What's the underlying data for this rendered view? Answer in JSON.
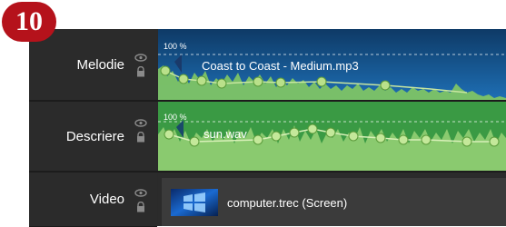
{
  "step_badge": "10",
  "tracks": [
    {
      "name": "Melodie",
      "clip": "Coast to Coast - Medium.mp3",
      "volume": "100 %"
    },
    {
      "name": "Descriere",
      "clip": "sun.wav",
      "volume": "100 %"
    },
    {
      "name": "Video",
      "clip": "computer.trec (Screen)"
    }
  ],
  "icons": {
    "visibility": "eye-icon",
    "lock": "lock-icon",
    "thumbnail": "video-thumbnail"
  },
  "colors": {
    "audio_clip_blue": "#1a5fa0",
    "waveform_green": "#7ec465",
    "audio_clip_green": "#3fa84a",
    "video_clip": "#3b3b3b",
    "header_bg": "#2b2b2b",
    "badge_red": "#b5121b"
  }
}
